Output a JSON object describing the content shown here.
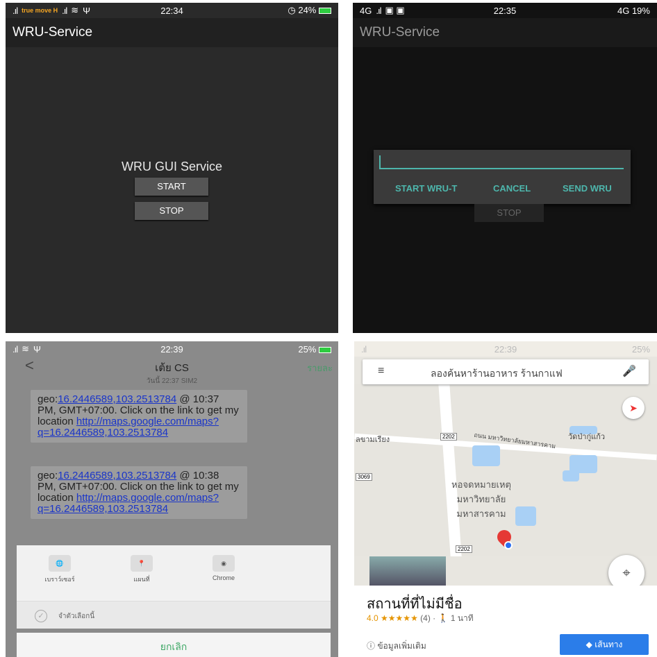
{
  "panel1": {
    "status": {
      "time": "22:34",
      "right": "24%",
      "carrier": "true move H"
    },
    "app_title": "WRU-Service",
    "gui_title": "WRU GUI Service",
    "start_label": "START",
    "stop_label": "STOP"
  },
  "panel2": {
    "status": {
      "left": "4G",
      "time": "22:35",
      "right": "4G 19%"
    },
    "app_title": "WRU-Service",
    "input_value": "",
    "actions": [
      "START WRU-T",
      "CANCEL",
      "SEND WRU"
    ],
    "stop_label": "STOP"
  },
  "panel3": {
    "status": {
      "time": "22:39",
      "right": "25%"
    },
    "contact": "เต้ย CS",
    "detail": "รายละ",
    "date": "วันนี้ 22:37 SIM2",
    "messages": [
      {
        "geo": "geo:",
        "coords": "16.2446589,103.2513784",
        "text": " @ 10:37 PM, GMT+07:00. Click on the link to get my location ",
        "link": "http://maps.google.com/maps?q=16.2446589,103.2513784"
      },
      {
        "geo": "geo:",
        "coords": "16.2446589,103.2513784",
        "text": " @ 10:38 PM, GMT+07:00. Click on the link to get my location ",
        "link": "http://maps.google.com/maps?q=16.2446589,103.2513784"
      }
    ],
    "apps": [
      "เบราว์เซอร์",
      "แผนที่",
      "Chrome"
    ],
    "remember": "จำตัวเลือกนี้",
    "cancel": "ยกเลิก"
  },
  "panel4": {
    "status": {
      "time": "22:39",
      "right": "25%"
    },
    "search_placeholder": "ลองค้นหาร้านอาหาร ร้านกาแฟ",
    "labels": {
      "left": "ลขามเรียง",
      "road": "ถนน มหาวิทยาลัยมหาสารคาม",
      "temple": "วัดป่ากู่แก้ว",
      "center": "หอจดหมายเหตุ มหาวิทยาลัย มหาสารคาม",
      "route1": "2202",
      "route2": "3069",
      "route3": "2202"
    },
    "place": "สถานที่ที่ไม่มีชื่อ",
    "rating": "4.0",
    "stars": "★★★★★",
    "reviews": "(4)",
    "walk": "1 นาที",
    "more_info": "ข้อมูลเพิ่มเติม",
    "directions": "เส้นทาง"
  },
  "icons": {
    "back": "chevron-left-icon",
    "menu": "hamburger-icon",
    "mic": "mic-icon",
    "compass": "compass-icon",
    "locate": "my-location-icon"
  }
}
